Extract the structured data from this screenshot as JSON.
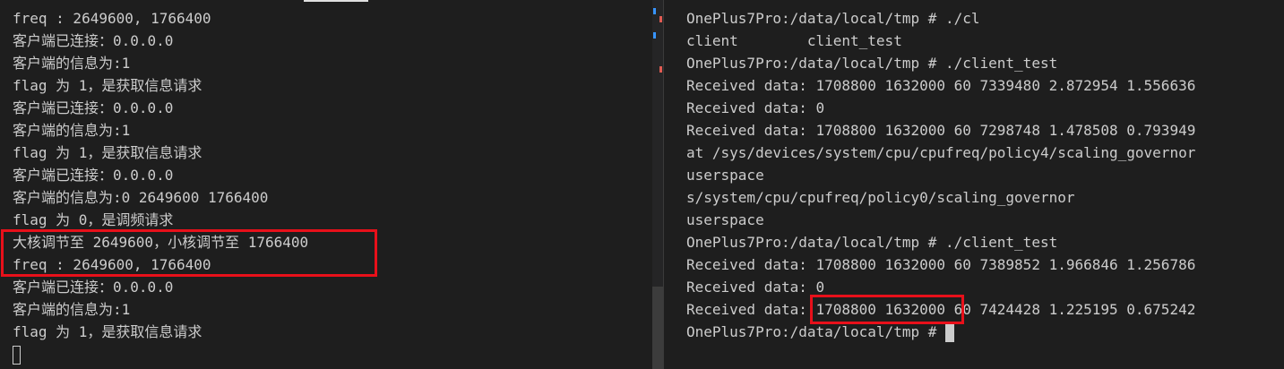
{
  "left_terminal": {
    "lines": [
      "freq : 2649600, 1766400",
      "客户端已连接：0.0.0.0",
      "客户端的信息为:1",
      "flag 为 1，是获取信息请求",
      "客户端已连接：0.0.0.0",
      "客户端的信息为:1",
      "flag 为 1，是获取信息请求",
      "客户端已连接：0.0.0.0",
      "客户端的信息为:0 2649600 1766400",
      "flag 为 0，是调频请求",
      "大核调节至 2649600，小核调节至 1766400",
      "freq : 2649600, 1766400",
      "客户端已连接：0.0.0.0",
      "客户端的信息为:1",
      "flag 为 1，是获取信息请求"
    ]
  },
  "right_terminal": {
    "lines": [
      "OnePlus7Pro:/data/local/tmp # ./cl",
      "client        client_test",
      "OnePlus7Pro:/data/local/tmp # ./client_test",
      "Received data: 1708800 1632000 60 7339480 2.872954 1.556636",
      "Received data: 0",
      "Received data: 1708800 1632000 60 7298748 1.478508 0.793949",
      "at /sys/devices/system/cpu/cpufreq/policy4/scaling_governor",
      "userspace",
      "s/system/cpu/cpufreq/policy0/scaling_governor",
      "userspace",
      "OnePlus7Pro:/data/local/tmp # ./client_test",
      "Received data: 1708800 1632000 60 7389852 1.966846 1.256786",
      "Received data: 0",
      "Received data: 1708800 1632000 60 7424428 1.225195 0.675242",
      "OnePlus7Pro:/data/local/tmp # "
    ]
  },
  "colors": {
    "background": "#1e1e1e",
    "text": "#cccccc",
    "highlight_box": "#e8101a",
    "scrollbar_mark_red": "#e05b52",
    "scrollbar_mark_blue": "#3794ff"
  }
}
